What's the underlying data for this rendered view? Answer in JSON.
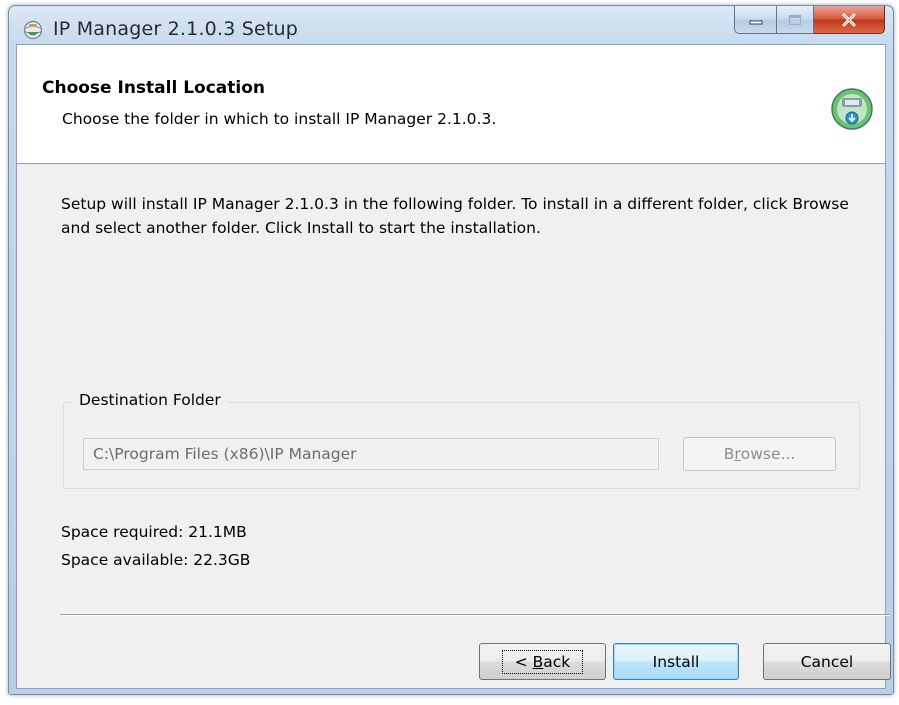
{
  "window": {
    "title": "IP Manager 2.1.0.3 Setup"
  },
  "header": {
    "title": "Choose Install Location",
    "subtitle": "Choose the folder in which to install IP Manager 2.1.0.3."
  },
  "body": {
    "intro_text": "Setup will install IP Manager 2.1.0.3 in the following folder. To install in a different folder, click Browse and select another folder. Click Install to start the installation."
  },
  "destination": {
    "group_label": "Destination Folder",
    "path_value": "C:\\Program Files (x86)\\IP Manager",
    "browse_label_pre": "B",
    "browse_label_accel": "r",
    "browse_label_post": "owse..."
  },
  "space": {
    "required": "Space required: 21.1MB",
    "available": "Space available: 22.3GB"
  },
  "buttons": {
    "back_pre": "< ",
    "back_accel": "B",
    "back_post": "ack",
    "install": "Install",
    "cancel": "Cancel"
  },
  "icons": {
    "app": "setup-globe-icon",
    "header": "install-disc-icon",
    "minimize": "minimize-icon",
    "maximize": "maximize-icon",
    "close": "close-icon"
  },
  "colors": {
    "titlebar": "#c5d8ec",
    "close_button": "#c2361b",
    "default_button_border": "#3c7fb1"
  }
}
